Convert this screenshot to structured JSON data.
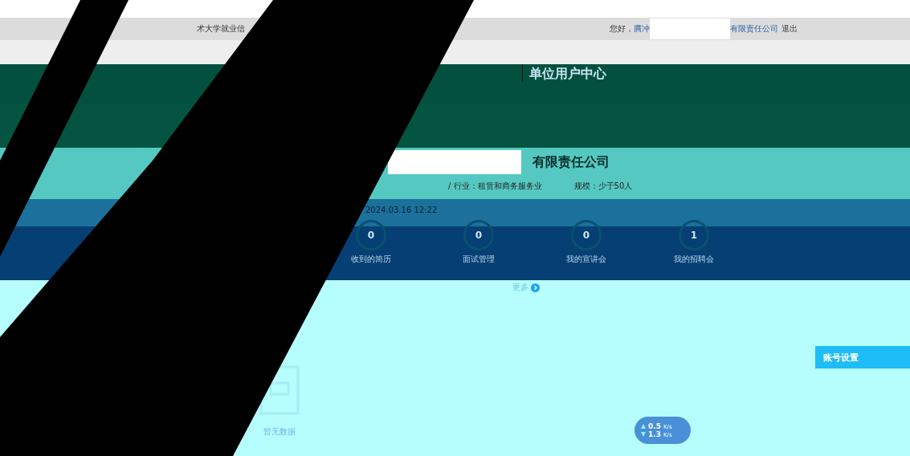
{
  "top_bar": {
    "site_fragment": "术大学就业信",
    "greeting": "您好，",
    "user_link_start": "腾冲",
    "user_link_end": "有限责任公司",
    "logout": "退出"
  },
  "header": {
    "title": "单位用户中心"
  },
  "company": {
    "name_suffix": "有限责任公司",
    "industry": "/ 行业：租赁和商务服务业",
    "scale": "规模：少于50人",
    "time": "2024.03.16 12:22"
  },
  "stats": [
    {
      "count": "0",
      "label": "收到的简历"
    },
    {
      "count": "0",
      "label": "面试管理"
    },
    {
      "count": "0",
      "label": "我的宣讲会"
    },
    {
      "count": "1",
      "label": "我的招聘会"
    }
  ],
  "more_link": "更多",
  "empty_state": "暂无数据",
  "sidebar": {
    "items": [
      {
        "label": "账号设置",
        "selected": true
      }
    ]
  },
  "speed_widget": {
    "upload": "0.5",
    "upload_unit": "K/s",
    "download": "1.3",
    "download_unit": "K/s"
  }
}
